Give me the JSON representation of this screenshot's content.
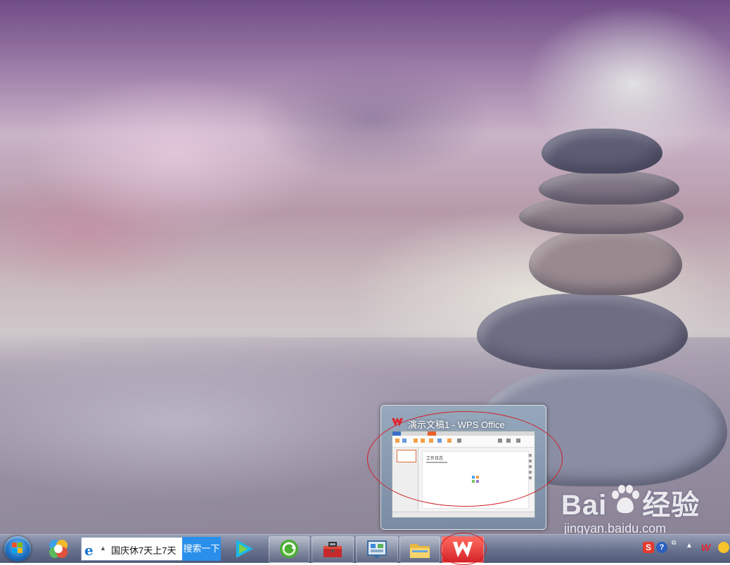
{
  "preview": {
    "window_title": "演示文稿1 - WPS Office",
    "slide_title": "工作日志"
  },
  "taskbar": {
    "search_query": "国庆休7天上7天",
    "search_button": "搜索一下",
    "pinned_icons": [
      "start-orb",
      "360-browser-icon",
      "ie-icon",
      "video-player-icon",
      "360-safe-icon",
      "toolbox-icon",
      "control-panel-icon",
      "file-explorer-icon",
      "wps-office-icon"
    ]
  },
  "watermark": {
    "logo_text": "Bai",
    "logo_text_2": "经验",
    "url": "jingyan.baidu.com"
  },
  "tray": {
    "sogou_label": "S",
    "help_label": "?"
  },
  "colors": {
    "annotation_red": "#d0202a",
    "search_button_blue": "#2a8fea",
    "wps_red": "#e0262d"
  }
}
